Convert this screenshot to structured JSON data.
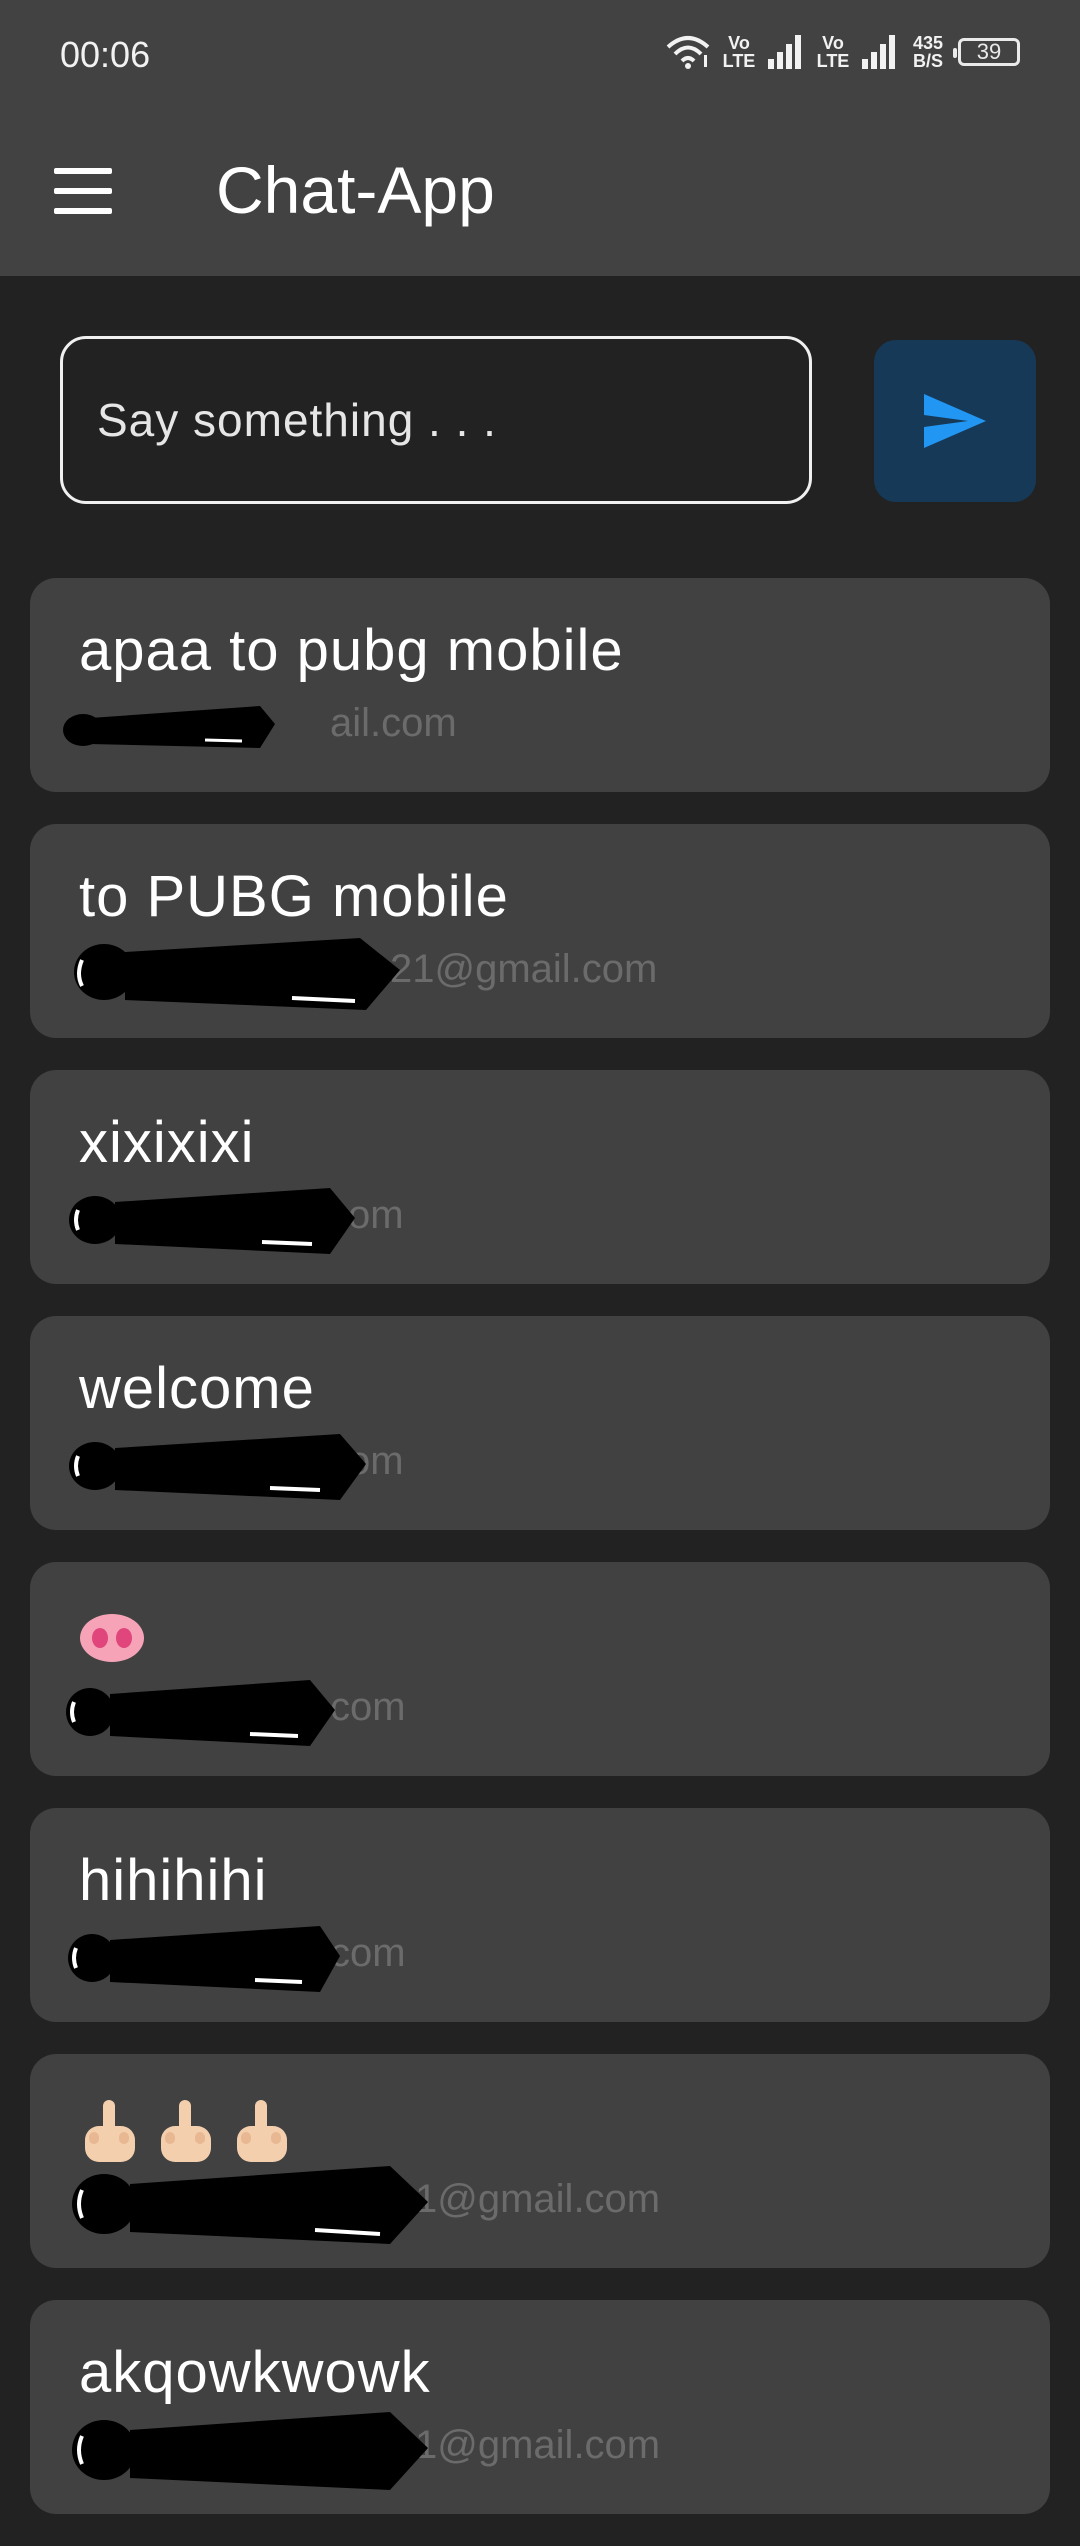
{
  "status_bar": {
    "time": "00:06",
    "vo_lte_1": "Vo LTE",
    "vo_lte_2": "Vo LTE",
    "net_speed": "435 B/S",
    "battery": "39"
  },
  "app_bar": {
    "title": "Chat-App",
    "menu_icon": "hamburger-menu-icon"
  },
  "composer": {
    "placeholder": "Say something . . .",
    "value": "",
    "send_icon": "send-arrow-icon"
  },
  "colors": {
    "background": "#222222",
    "app_bar": "#424242",
    "card": "#414141",
    "send_button": "#163957",
    "send_icon": "#2196f3",
    "email_text": "#6b6b6b"
  },
  "messages": [
    {
      "text": "apaa to pubg mobile",
      "email_visible": "ail.com"
    },
    {
      "text": "to PUBG mobile",
      "email_visible": "21@gmail.com"
    },
    {
      "text": "xixixixi",
      "email_visible": "om"
    },
    {
      "text": "welcome",
      "email_visible": "om"
    },
    {
      "text": "",
      "emoji": "pig-nose-emoji",
      "email_visible": "com"
    },
    {
      "text": "hihihihi",
      "email_visible": "com"
    },
    {
      "text": "",
      "emoji": "middle-finger-emoji-x3",
      "email_visible": "1@gmail.com"
    },
    {
      "text": "akqowkwowk",
      "email_visible": "1@gmail.com"
    }
  ]
}
